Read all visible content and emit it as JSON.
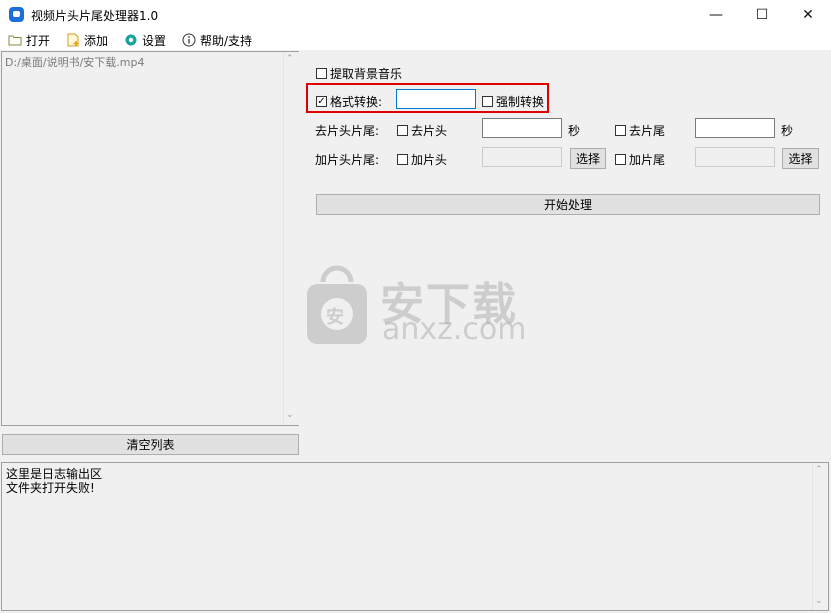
{
  "window": {
    "title": "视频片头片尾处理器1.0",
    "minimize": "—",
    "maximize": "☐",
    "close": "✕"
  },
  "menu": {
    "open": "打开",
    "add": "添加",
    "settings": "设置",
    "help": "帮助/支持"
  },
  "file_list": {
    "items": [
      "D:/桌面/说明书/安下载.mp4"
    ],
    "clear_button": "清空列表"
  },
  "options": {
    "extract_bgm": {
      "label": "提取背景音乐",
      "checked": false
    },
    "format_convert": {
      "label": "格式转换:",
      "checked": true,
      "value": ""
    },
    "force_convert": {
      "label": "强制转换",
      "checked": false
    },
    "trim_row_label": "去片头片尾:",
    "remove_head": {
      "label": "去片头",
      "checked": false,
      "value": "",
      "unit": "秒"
    },
    "remove_tail": {
      "label": "去片尾",
      "checked": false,
      "value": "",
      "unit": "秒"
    },
    "add_row_label": "加片头片尾:",
    "add_head": {
      "label": "加片头",
      "checked": false,
      "value": "",
      "button": "选择"
    },
    "add_tail": {
      "label": "加片尾",
      "checked": false,
      "value": "",
      "button": "选择"
    },
    "start_button": "开始处理"
  },
  "watermark": {
    "title": "安下载",
    "url": "anxz.com",
    "badge": "安"
  },
  "log": {
    "lines": [
      "这里是日志输出区",
      "文件夹打开失败!"
    ]
  }
}
